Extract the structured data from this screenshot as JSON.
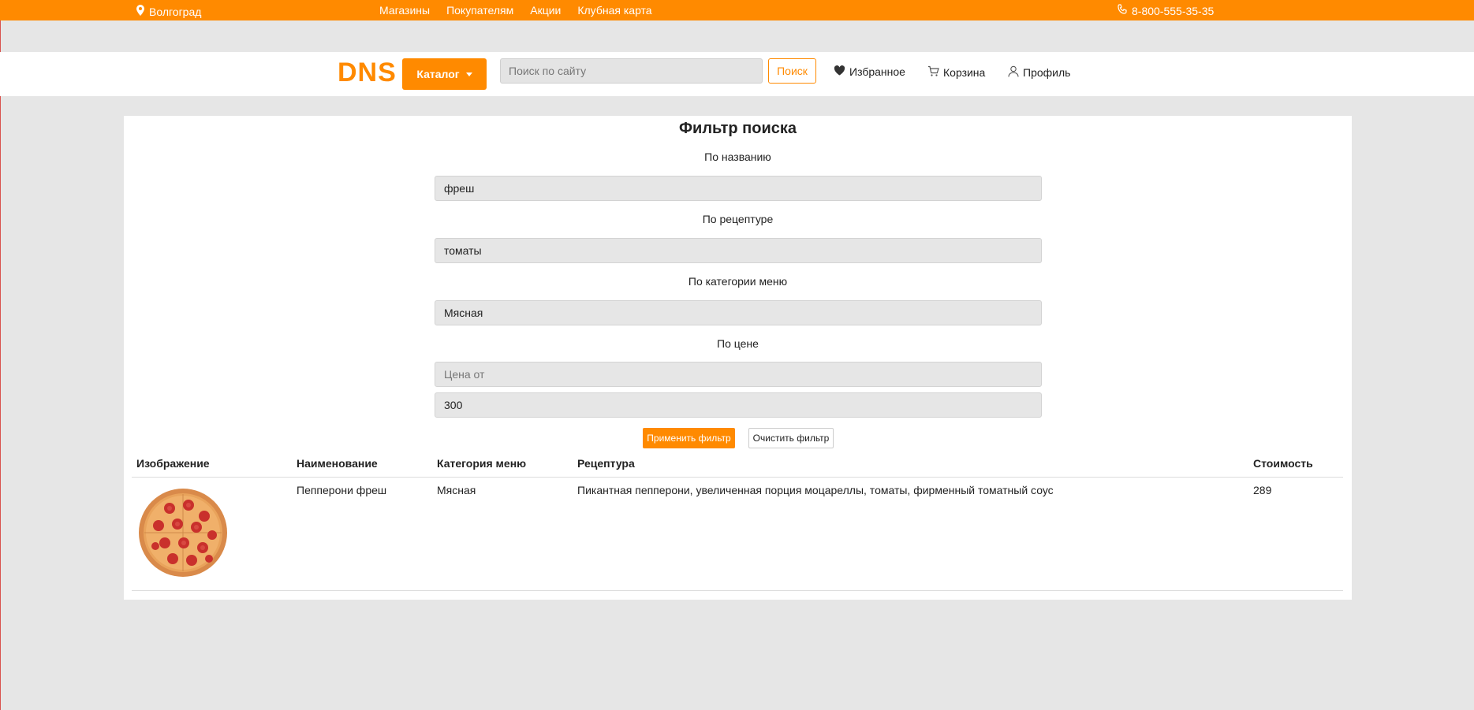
{
  "topbar": {
    "city": "Волгоград",
    "nav": [
      "Магазины",
      "Покупателям",
      "Акции",
      "Клубная карта"
    ],
    "phone": "8-800-555-35-35"
  },
  "header": {
    "logo": "DNS",
    "catalog_label": "Каталог",
    "search_placeholder": "Поиск по сайту",
    "search_button": "Поиск",
    "favorites": "Избранное",
    "cart": "Корзина",
    "profile": "Профиль"
  },
  "filter": {
    "title": "Фильтр поиска",
    "by_name_label": "По названию",
    "by_name_value": "фреш",
    "by_recipe_label": "По рецептуре",
    "by_recipe_value": "томаты",
    "by_category_label": "По категории меню",
    "by_category_value": "Мясная",
    "by_price_label": "По цене",
    "price_from_placeholder": "Цена от",
    "price_to_value": "300",
    "apply_button": "Применить фильтр",
    "clear_button": "Очистить фильтр"
  },
  "table": {
    "headers": [
      "Изображение",
      "Наименование",
      "Категория меню",
      "Рецептура",
      "Стоимость"
    ],
    "rows": [
      {
        "image": "pepperoni-pizza",
        "name": "Пепперони фреш",
        "category": "Мясная",
        "recipe": "Пикантная пепперони, увеличенная порция моцареллы, томаты, фирменный томатный соус",
        "price": "289"
      }
    ]
  },
  "colors": {
    "accent": "#ff8a00",
    "background": "#e6e6e6"
  }
}
